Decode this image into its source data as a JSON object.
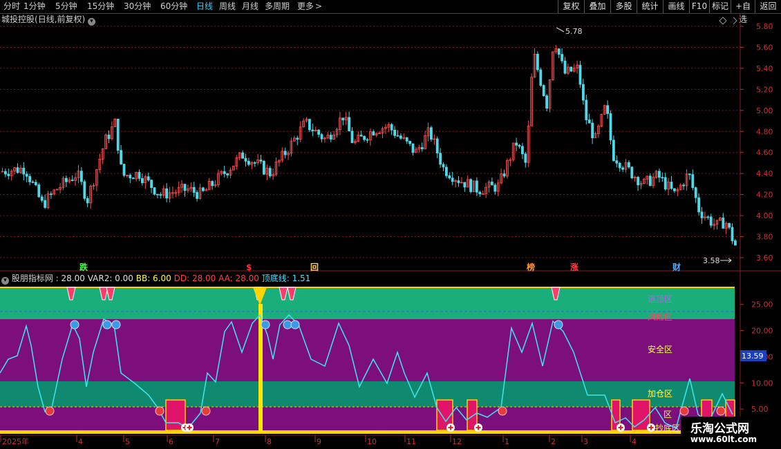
{
  "toolbar": {
    "periods": [
      {
        "label": "分时",
        "active": false
      },
      {
        "label": "1分钟",
        "active": false
      },
      {
        "label": "5分钟",
        "active": false
      },
      {
        "label": "15分钟",
        "active": false
      },
      {
        "label": "30分钟",
        "active": false
      },
      {
        "label": "60分钟",
        "active": false
      },
      {
        "label": "日线",
        "active": true
      },
      {
        "label": "周线",
        "active": false
      },
      {
        "label": "月线",
        "active": false
      },
      {
        "label": "多周期",
        "active": false
      },
      {
        "label": "更多",
        "active": false
      }
    ],
    "more_arrow": ">",
    "tools": [
      "复权",
      "叠加",
      "多股",
      "统计",
      "画线",
      "F10",
      "标记",
      "+自选",
      "返回"
    ]
  },
  "stock": {
    "name": "城投控股",
    "mode": "(日线,前复权)",
    "price_ticks": [
      "5.80",
      "5.60",
      "5.40",
      "5.20",
      "5.00",
      "4.80",
      "4.60",
      "4.40",
      "4.20",
      "4.00",
      "3.80",
      "3.60"
    ],
    "high_label": "5.78",
    "low_label": "3.58",
    "event_markers": [
      {
        "text": "跌",
        "color": "#44ff44"
      },
      {
        "text": "$",
        "color": "#ff3333"
      },
      {
        "text": "回",
        "color": "#ffcc66"
      },
      {
        "text": "榜",
        "color": "#ff9933"
      },
      {
        "text": "涨",
        "color": "#ff4444"
      },
      {
        "text": "财",
        "color": "#55aaff"
      }
    ]
  },
  "indicator": {
    "name": "股朋指标网",
    "params": [
      {
        "label": "28.00",
        "color": "#e0e0e0"
      },
      {
        "label": "VAR2: 0.00",
        "color": "#e0e0e0"
      },
      {
        "label": "BB: 6.00",
        "color": "#ffff55"
      },
      {
        "label": "DD: 28.00",
        "color": "#ff4444"
      },
      {
        "label": "AA: 28.00",
        "color": "#ff4444"
      },
      {
        "label": "顶底线: 1.51",
        "color": "#55ddff"
      }
    ],
    "axis_ticks": [
      "25.00",
      "20.00",
      "15.00",
      "10.00",
      "5.00"
    ],
    "current_value": "13.59",
    "zones": [
      "逃顶区",
      "风险区",
      "安全区",
      "加仓区",
      "抄底区"
    ],
    "zone_partial": "区",
    "zone_colors": {
      "top": "#1aaf7a",
      "risk": "#880088",
      "safe": "#7c0f7c",
      "add": "#0f8a6f",
      "bottom": "#7c0f7c"
    }
  },
  "x_axis": {
    "labels": [
      "2025年",
      "4",
      "5",
      "6",
      "7",
      "8",
      "9",
      "10",
      "11",
      "12",
      "1",
      "2",
      "3",
      "4"
    ]
  },
  "watermark": {
    "title": "乐淘公式网",
    "url": "www.60lt.com"
  }
}
